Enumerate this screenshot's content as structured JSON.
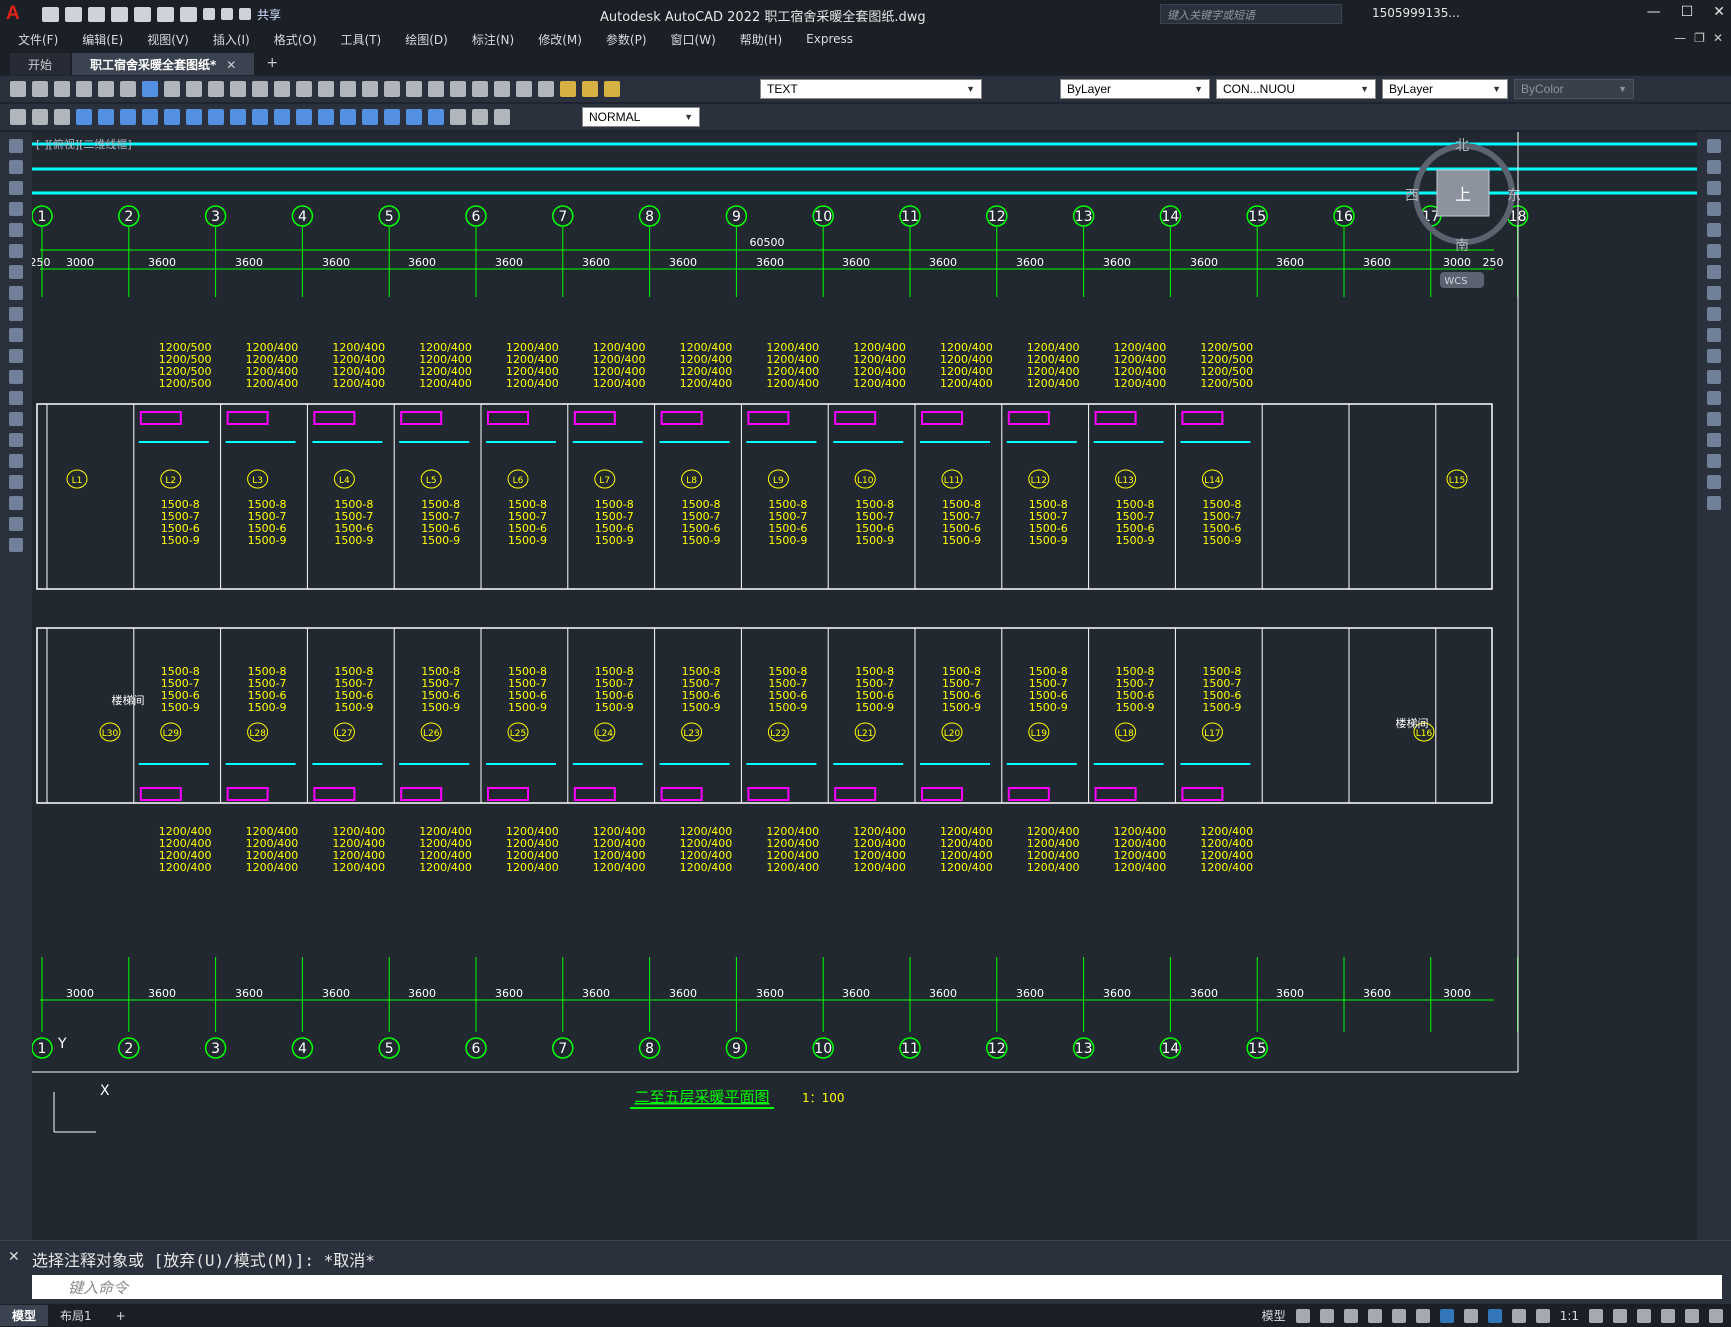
{
  "app": {
    "title": "Autodesk AutoCAD 2022    职工宿舍采暖全套图纸.dwg",
    "share_label": "共享",
    "search_placeholder": "键入关键字或短语",
    "user": "1505999135..."
  },
  "menu": [
    "文件(F)",
    "编辑(E)",
    "视图(V)",
    "插入(I)",
    "格式(O)",
    "工具(T)",
    "绘图(D)",
    "标注(N)",
    "修改(M)",
    "参数(P)",
    "窗口(W)",
    "帮助(H)",
    "Express"
  ],
  "tabs": [
    {
      "label": "开始",
      "active": false
    },
    {
      "label": "职工宿舍采暖全套图纸*",
      "active": true
    }
  ],
  "toolbar": {
    "textstyle": "TEXT",
    "layer_color": "ByLayer",
    "linetype": "CON...NUOU",
    "lineweight": "ByLayer",
    "plotstyle": "ByColor",
    "dimstyle": "NORMAL"
  },
  "viewport_label": "[-][俯视][二维线框]",
  "viewcube": {
    "north": "北",
    "south": "南",
    "east": "东",
    "west": "西",
    "top": "上",
    "wcs": "WCS"
  },
  "drawing": {
    "overall_dim": "60500",
    "top_axes": [
      "1",
      "2",
      "3",
      "4",
      "5",
      "6",
      "7",
      "8",
      "9",
      "10",
      "11",
      "12",
      "13",
      "14",
      "15",
      "16",
      "17",
      "18"
    ],
    "bottom_axes": [
      "1",
      "2",
      "3",
      "4",
      "5",
      "6",
      "7",
      "8",
      "9",
      "10",
      "11",
      "12",
      "13",
      "14",
      "15"
    ],
    "top_dims": [
      "250",
      "3000",
      "3600",
      "3600",
      "3600",
      "3600",
      "3600",
      "3600",
      "3600",
      "3600",
      "3600",
      "3600",
      "3600",
      "3600",
      "3600",
      "3600",
      "3600",
      "3000",
      "250"
    ],
    "bottom_dims": [
      "3000",
      "3600",
      "3600",
      "3600",
      "3600",
      "3600",
      "3600",
      "3600",
      "3600",
      "3600",
      "3600",
      "3600",
      "3600",
      "3600",
      "3600",
      "3600",
      "3000"
    ],
    "upper_room_tags": [
      "L1",
      "L2",
      "L3",
      "L4",
      "L5",
      "L6",
      "L7",
      "L8",
      "L9",
      "L10",
      "L11",
      "L12",
      "L13",
      "L14",
      "L15"
    ],
    "lower_room_tags": [
      "L30",
      "L29",
      "L28",
      "L27",
      "L26",
      "L25",
      "L24",
      "L23",
      "L22",
      "L21",
      "L20",
      "L19",
      "L18",
      "L17",
      "L16"
    ],
    "radiator_top_labels": [
      "1200/500",
      "1200/400"
    ],
    "radiator_mid_labels": [
      "1500-8",
      "1500-7",
      "1500-6",
      "1500-9"
    ],
    "room_name": "楼梯间",
    "title": "二至五层采暖平面图",
    "scale": "1：100"
  },
  "command": {
    "history": "选择注释对象或 [放弃(U)/模式(M)]: *取消*",
    "placeholder": "键入命令"
  },
  "status": {
    "layouts": [
      "模型",
      "布局1"
    ],
    "model_label": "模型",
    "scale": "1:1"
  },
  "colors": {
    "axis": "#00ff00",
    "dim": "#00ff00",
    "wall": "#ffffff",
    "label": "#ffff00",
    "pipe": "#00ffff",
    "radiator": "#ff00ff"
  }
}
